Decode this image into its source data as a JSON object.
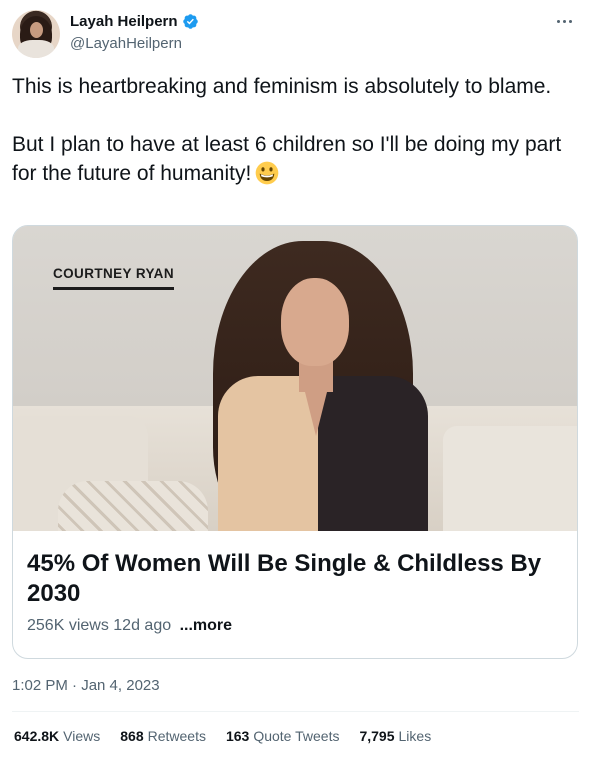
{
  "tweet": {
    "author_name": "Layah Heilpern",
    "handle": "@LayahHeilpern",
    "text": "This is heartbreaking and feminism is absolutely to blame.\n\nBut I plan to have at least 6 children so I'll be doing my part for the future of humanity!",
    "timestamp": "1:02 PM · Jan 4, 2023"
  },
  "card": {
    "video_caption": "COURTNEY RYAN",
    "title": "45% Of Women Will Be Single & Childless By 2030",
    "views": "256K views",
    "age": "12d ago",
    "more_label": "...more"
  },
  "stats": [
    {
      "value": "642.8K",
      "label": "Views"
    },
    {
      "value": "868",
      "label": "Retweets"
    },
    {
      "value": "163",
      "label": "Quote Tweets"
    },
    {
      "value": "7,795",
      "label": "Likes"
    }
  ],
  "icons": {
    "verified": "verified-badge-icon",
    "more": "more-options-icon",
    "emoji": "grinning-emoji-icon"
  },
  "colors": {
    "verified_blue": "#1d9bf0",
    "text_primary": "#0f1419",
    "text_secondary": "#536471",
    "border": "#cfd9de"
  }
}
